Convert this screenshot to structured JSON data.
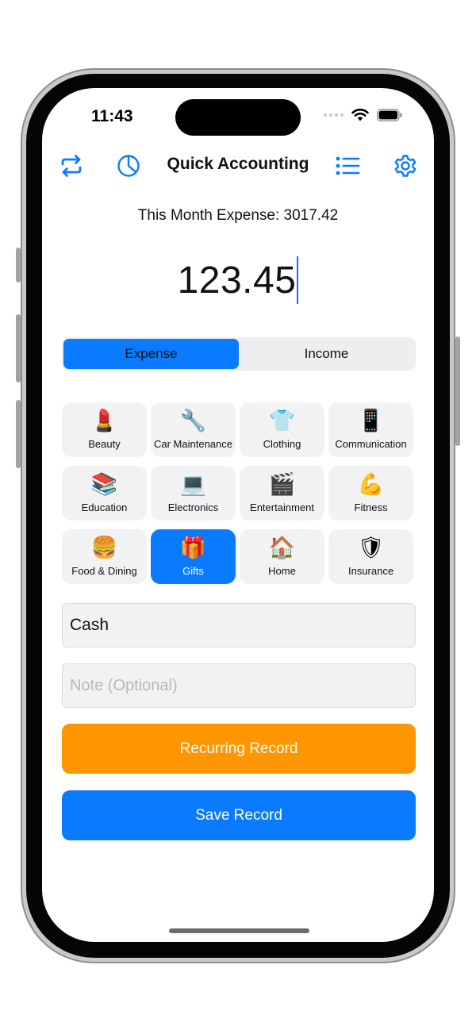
{
  "status_bar": {
    "time": "11:43"
  },
  "nav": {
    "title": "Quick Accounting",
    "icons": [
      "swap-icon",
      "pie-chart-icon",
      "list-icon",
      "gear-icon"
    ]
  },
  "summary": {
    "month_expense": "This Month Expense: 3017.42"
  },
  "amount": {
    "value": "123.45"
  },
  "type_toggle": {
    "options": [
      "Expense",
      "Income"
    ],
    "selected": "Expense"
  },
  "categories": [
    {
      "label": "Beauty",
      "icon": "💄"
    },
    {
      "label": "Car Maintenance",
      "icon": "🔧"
    },
    {
      "label": "Clothing",
      "icon": "👕"
    },
    {
      "label": "Communication",
      "icon": "📱"
    },
    {
      "label": "Education",
      "icon": "📚"
    },
    {
      "label": "Electronics",
      "icon": "💻"
    },
    {
      "label": "Entertainment",
      "icon": "🎬"
    },
    {
      "label": "Fitness",
      "icon": "💪"
    },
    {
      "label": "Food & Dining",
      "icon": "🍔"
    },
    {
      "label": "Gifts",
      "icon": "🎁"
    },
    {
      "label": "Home",
      "icon": "🏠"
    },
    {
      "label": "Insurance",
      "icon": "🛡"
    }
  ],
  "selected_category": "Gifts",
  "form": {
    "account_value": "Cash",
    "note_placeholder": "Note (Optional)"
  },
  "actions": {
    "recurring_label": "Recurring Record",
    "save_label": "Save Record"
  },
  "colors": {
    "accent": "#0a7aff",
    "recurring": "#ff9500",
    "tile_bg": "#f2f2f4"
  }
}
